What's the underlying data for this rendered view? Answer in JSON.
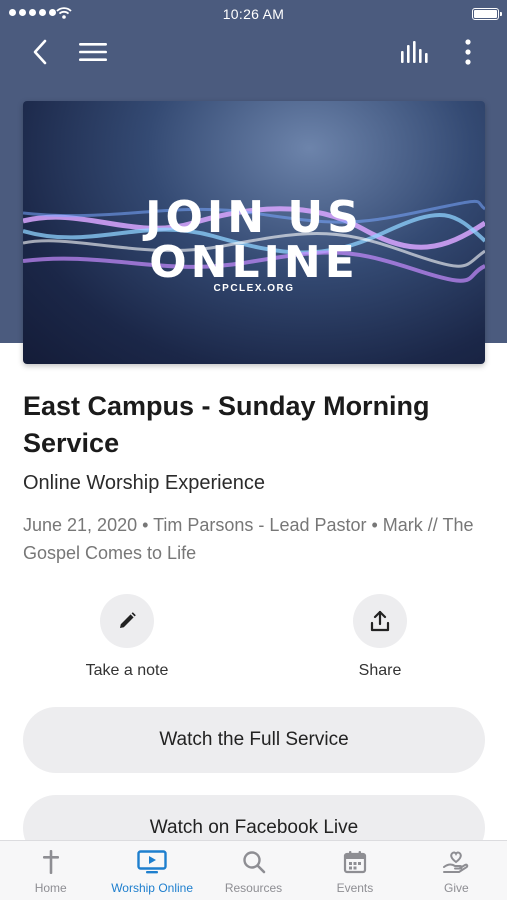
{
  "status_bar": {
    "time": "10:26 AM"
  },
  "banner": {
    "line1": "JOIN US",
    "line2": "ONLINE",
    "url": "CPCLEX.ORG"
  },
  "content": {
    "title": "East Campus - Sunday Morning Service",
    "subtitle": "Online Worship Experience",
    "meta": "June 21, 2020 • Tim Parsons - Lead Pastor • Mark // The Gospel Comes to Life"
  },
  "actions": {
    "note_label": "Take a note",
    "share_label": "Share"
  },
  "buttons": {
    "watch_full": "Watch the Full Service",
    "watch_facebook": "Watch on Facebook Live"
  },
  "tabs": [
    {
      "label": "Home",
      "icon": "cross-icon"
    },
    {
      "label": "Worship Online",
      "icon": "tv-play-icon",
      "active": true
    },
    {
      "label": "Resources",
      "icon": "search-icon"
    },
    {
      "label": "Events",
      "icon": "calendar-icon"
    },
    {
      "label": "Give",
      "icon": "heart-hand-icon"
    }
  ],
  "colors": {
    "header_bg": "#4b5b7e",
    "accent": "#1e7fce",
    "inactive_tab": "#8e8e93",
    "pill_bg": "#ededef"
  }
}
